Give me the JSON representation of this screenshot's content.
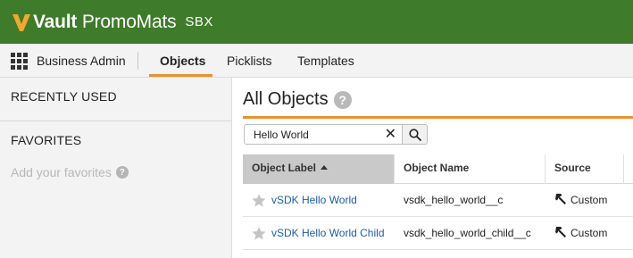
{
  "header": {
    "brand_bold": "Vault",
    "brand_rest": " PromoMats",
    "environment": "SBX",
    "colors": {
      "header_bg": "#3e7b2a",
      "logo_v": "#f0a830"
    }
  },
  "nav": {
    "app_name": "Business Admin",
    "tabs": [
      {
        "label": "Objects",
        "active": true
      },
      {
        "label": "Picklists",
        "active": false
      },
      {
        "label": "Templates",
        "active": false
      }
    ],
    "accent": "#e8912d"
  },
  "sidebar": {
    "recently_used": "RECENTLY USED",
    "favorites": "FAVORITES",
    "favorites_empty": "Add your favorites"
  },
  "main": {
    "title": "All Objects",
    "search": {
      "value": "Hello World"
    },
    "table": {
      "columns": [
        {
          "label": "Object Label",
          "sorted": "asc"
        },
        {
          "label": "Object Name"
        },
        {
          "label": "Source"
        }
      ],
      "rows": [
        {
          "label": "vSDK Hello World",
          "name": "vsdk_hello_world__c",
          "source": "Custom",
          "favorite": false
        },
        {
          "label": "vSDK Hello World Child",
          "name": "vsdk_hello_world_child__c",
          "source": "Custom",
          "favorite": false
        }
      ]
    }
  }
}
